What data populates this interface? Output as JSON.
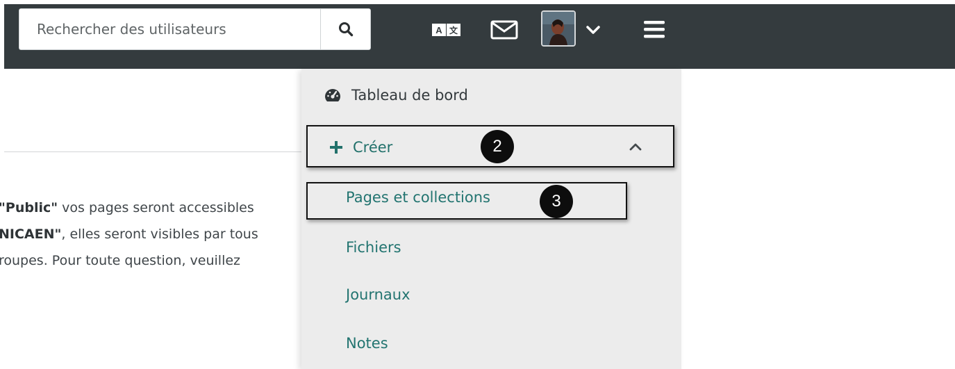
{
  "navbar": {
    "search": {
      "placeholder": "Rechercher des utilisateurs",
      "button_icon": "search-icon"
    },
    "icons": [
      "translate-icon",
      "mail-icon",
      "avatar",
      "chevron-down-icon",
      "hamburger-menu-icon"
    ],
    "background_color": "#343b3e"
  },
  "body": {
    "lines": [
      {
        "bold": "\"Public\"",
        "text": " vos pages seront accessibles"
      },
      {
        "bold": "NICAEN\"",
        "text": ", elles seront visibles par tous"
      },
      {
        "bold": "",
        "text": "roupes. Pour toute question, veuillez"
      }
    ]
  },
  "dropdown": {
    "dashboard": {
      "label": "Tableau de bord",
      "icon": "dashboard-icon"
    },
    "create": {
      "label": "Créer",
      "icon": "plus-icon",
      "expanded_icon": "chevron-up-icon",
      "step": "2"
    },
    "submenu": [
      {
        "label": "Pages et collections",
        "step": "3"
      },
      {
        "label": "Fichiers"
      },
      {
        "label": "Journaux"
      },
      {
        "label": "Notes"
      }
    ],
    "accent_color": "#227470",
    "background_color": "#ececec"
  }
}
